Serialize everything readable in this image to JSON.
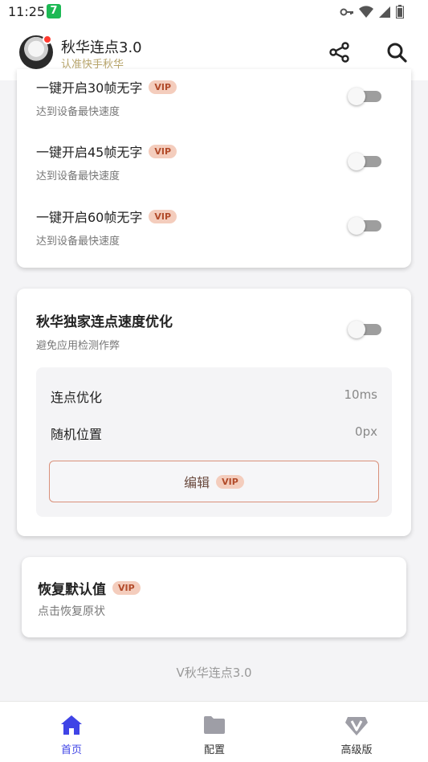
{
  "status_bar": {
    "time": "11:25",
    "badge": "7",
    "icons": [
      "key-icon",
      "wifi-icon",
      "signal-icon",
      "battery-icon"
    ]
  },
  "header": {
    "title": "秋华连点3.0",
    "subtitle": "认准快手秋华",
    "actions": [
      "share-icon",
      "search-icon"
    ]
  },
  "fps_options": [
    {
      "title": "一键开启30帧无字",
      "badge": "VIP",
      "subtitle": "达到设备最快速度",
      "enabled": false
    },
    {
      "title": "一键开启45帧无字",
      "badge": "VIP",
      "subtitle": "达到设备最快速度",
      "enabled": false
    },
    {
      "title": "一键开启60帧无字",
      "badge": "VIP",
      "subtitle": "达到设备最快速度",
      "enabled": false
    }
  ],
  "speed_card": {
    "title": "秋华独家连点速度优化",
    "subtitle": "避免应用检测作弊",
    "enabled": false,
    "settings": [
      {
        "label": "连点优化",
        "value": "10ms"
      },
      {
        "label": "随机位置",
        "value": "0px"
      }
    ],
    "edit_label": "编辑",
    "edit_badge": "VIP"
  },
  "restore_card": {
    "title": "恢复默认值",
    "badge": "VIP",
    "subtitle": "点击恢复原状"
  },
  "footer": {
    "version": "V秋华连点3.0"
  },
  "bottom_nav": [
    {
      "label": "首页",
      "icon": "home-icon",
      "active": true
    },
    {
      "label": "配置",
      "icon": "folder-icon",
      "active": false
    },
    {
      "label": "高级版",
      "icon": "v-badge-icon",
      "active": false
    }
  ],
  "colors": {
    "accent": "#3f44e6",
    "vip_bg": "#f4cdbd",
    "vip_text": "#b24b2a",
    "subtitle_gold": "#b7a46b"
  }
}
